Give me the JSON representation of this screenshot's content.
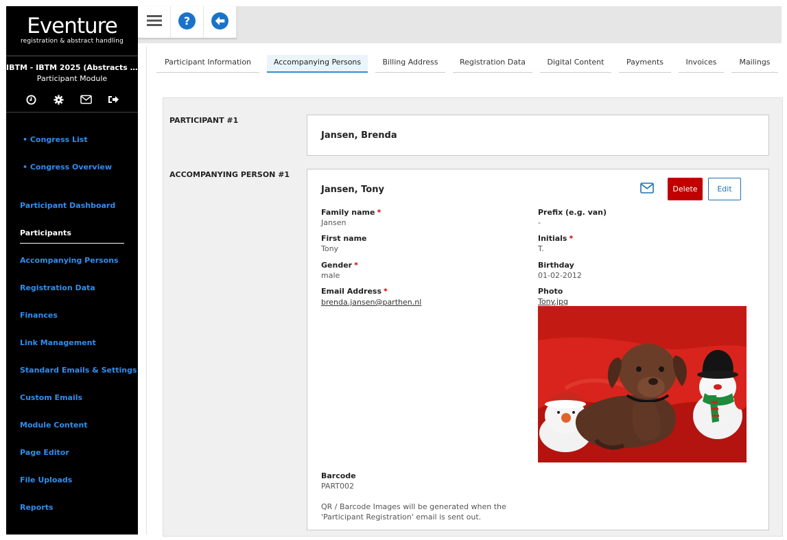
{
  "sidebar": {
    "logo_name": "Eventure",
    "logo_tagline": "registration & abstract handling",
    "congress_title": "IBTM - IBTM 2025 (Abstracts & Participants)",
    "module_name": "Participant Module",
    "sub_links": [
      "• Congress List",
      "• Congress Overview"
    ],
    "nav": [
      "Participant Dashboard",
      "Participants",
      "Accompanying Persons",
      "Registration Data",
      "Finances",
      "Link Management",
      "Standard Emails & Settings",
      "Custom Emails",
      "Module Content",
      "Page Editor",
      "File Uploads",
      "Reports"
    ],
    "active_nav": "Participants",
    "icons": [
      "clock-icon",
      "gear-icon",
      "envelope-icon",
      "logout-icon"
    ]
  },
  "toolbar": {
    "icons": [
      "menu-icon",
      "help-icon",
      "back-icon"
    ]
  },
  "tabs": [
    "Participant Information",
    "Accompanying Persons",
    "Billing Address",
    "Registration Data",
    "Digital Content",
    "Payments",
    "Invoices",
    "Mailings"
  ],
  "active_tab": "Accompanying Persons",
  "participant": {
    "label": "PARTICIPANT #1",
    "name": "Jansen, Brenda"
  },
  "accompanying": {
    "label": "ACCOMPANYING PERSON #1",
    "name": "Jansen, Tony",
    "delete_label": "Delete",
    "edit_label": "Edit",
    "fields": {
      "family_name": {
        "label": "Family name",
        "value": "Jansen"
      },
      "prefix": {
        "label": "Prefix (e.g. van)",
        "value": "-"
      },
      "first_name": {
        "label": "First name",
        "value": "Tony"
      },
      "initials": {
        "label": "Initials",
        "value": "T."
      },
      "gender": {
        "label": "Gender",
        "value": "male"
      },
      "birthday": {
        "label": "Birthday",
        "value": "01-02-2012"
      },
      "email": {
        "label": "Email Address",
        "value": "brenda.jansen@parthen.nl"
      },
      "photo": {
        "label": "Photo",
        "value": "Tony.jpg"
      },
      "barcode": {
        "label": "Barcode",
        "value": "PART002"
      }
    },
    "barcode_note_line1": "QR / Barcode Images will be generated when the",
    "barcode_note_line2": "'Participant Registration' email is sent out."
  },
  "colors": {
    "accent": "#2f8ef0",
    "delete": "#c00000",
    "edit": "#1e6fb5"
  }
}
